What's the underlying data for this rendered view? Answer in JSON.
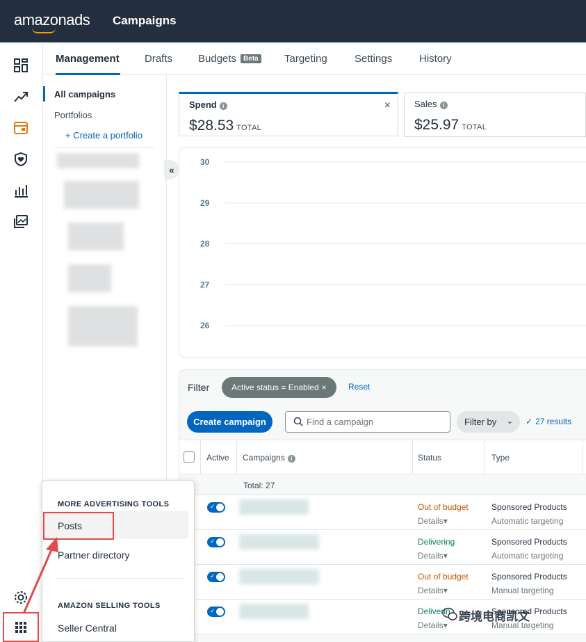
{
  "header": {
    "logo_brand": "amazon",
    "logo_product": "ads",
    "title": "Campaigns"
  },
  "tabs": [
    {
      "label": "Management"
    },
    {
      "label": "Drafts"
    },
    {
      "label": "Budgets",
      "badge": "Beta"
    },
    {
      "label": "Targeting"
    },
    {
      "label": "Settings"
    },
    {
      "label": "History"
    }
  ],
  "rail_icons": [
    "dashboard-icon",
    "trending-icon",
    "campaigns-icon",
    "shield-icon",
    "reports-icon",
    "media-icon",
    "gear-icon",
    "apps-grid-icon"
  ],
  "subnav": {
    "all_campaigns": "All campaigns",
    "portfolios": "Portfolios",
    "create_portfolio": "+ Create a portfolio",
    "collapse": "«"
  },
  "metrics": [
    {
      "label": "Spend",
      "value": "$28.53",
      "suffix": "TOTAL",
      "close": "×"
    },
    {
      "label": "Sales",
      "value": "$25.97",
      "suffix": "TOTAL"
    }
  ],
  "chart_data": {
    "type": "line",
    "y_ticks": [
      30,
      29,
      28,
      27,
      26
    ],
    "ylim": [
      26,
      30
    ],
    "grid": true,
    "series": []
  },
  "filter": {
    "label": "Filter",
    "chip": "Active status = Enabled",
    "chip_close": "×",
    "reset": "Reset",
    "create_button": "Create campaign",
    "search_placeholder": "Find a campaign",
    "filter_by": "Filter by",
    "results": "27 results"
  },
  "table": {
    "headers": {
      "active": "Active",
      "campaigns": "Campaigns",
      "status": "Status",
      "type": "Type"
    },
    "total": "Total: 27",
    "rows": [
      {
        "status": "Out of budget",
        "status_kind": "oob",
        "details": "Details",
        "type": "Sponsored Products",
        "targeting": "Automatic targeting"
      },
      {
        "status": "Delivering",
        "status_kind": "del",
        "details": "Details",
        "type": "Sponsored Products",
        "targeting": "Automatic targeting"
      },
      {
        "status": "Out of budget",
        "status_kind": "oob",
        "details": "Details",
        "type": "Sponsored Products",
        "targeting": "Manual targeting"
      },
      {
        "status": "Deliverin",
        "status_kind": "del",
        "details": "Details",
        "type": "Sponsored Products",
        "targeting": "Manual targeting"
      }
    ]
  },
  "menu": {
    "more_tools_header": "MORE ADVERTISING TOOLS",
    "posts": "Posts",
    "partner_directory": "Partner directory",
    "selling_tools_header": "AMAZON SELLING TOOLS",
    "seller_central": "Seller Central"
  },
  "watermark": "跨境电商凯文",
  "colors": {
    "accent": "#0066c0",
    "topbar": "#232f3e",
    "out_of_budget": "#c45500",
    "delivering": "#067d62",
    "highlight": "#e04b4b"
  }
}
